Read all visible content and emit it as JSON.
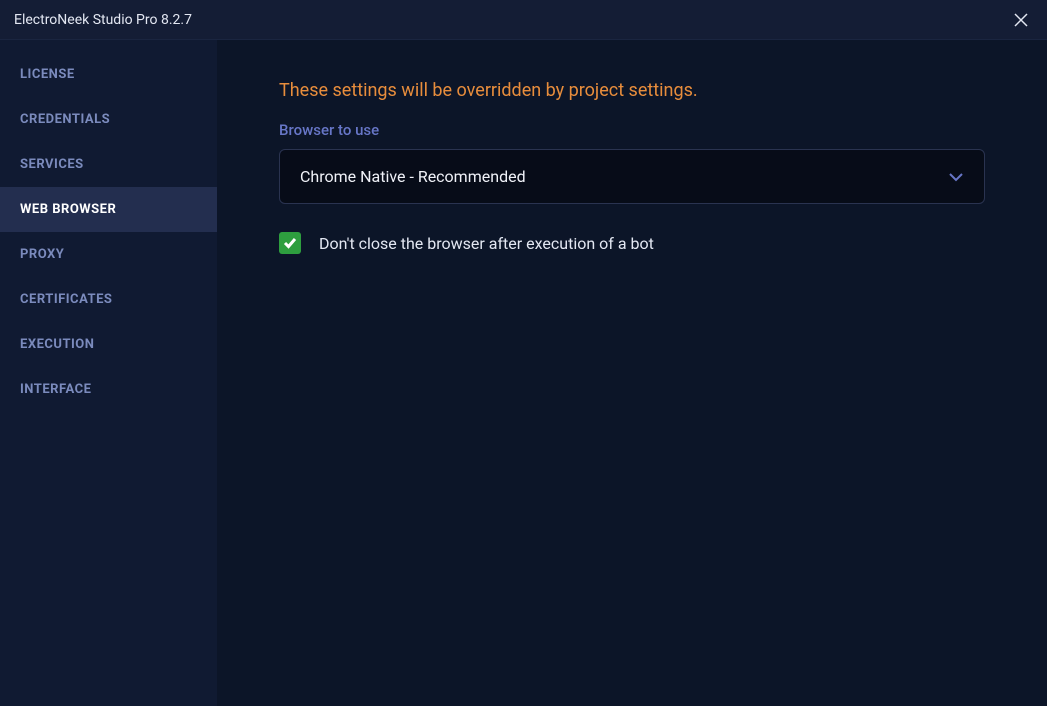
{
  "titlebar": {
    "title": "ElectroNeek Studio Pro 8.2.7"
  },
  "sidebar": {
    "items": [
      {
        "label": "LICENSE"
      },
      {
        "label": "CREDENTIALS"
      },
      {
        "label": "SERVICES"
      },
      {
        "label": "WEB BROWSER"
      },
      {
        "label": "PROXY"
      },
      {
        "label": "CERTIFICATES"
      },
      {
        "label": "EXECUTION"
      },
      {
        "label": "INTERFACE"
      }
    ]
  },
  "main": {
    "warning": "These settings will be overridden by project settings.",
    "browser_label": "Browser to use",
    "browser_selected": "Chrome Native - Recommended",
    "checkbox_label": "Don't close the browser after execution of a bot",
    "checkbox_checked": true
  }
}
